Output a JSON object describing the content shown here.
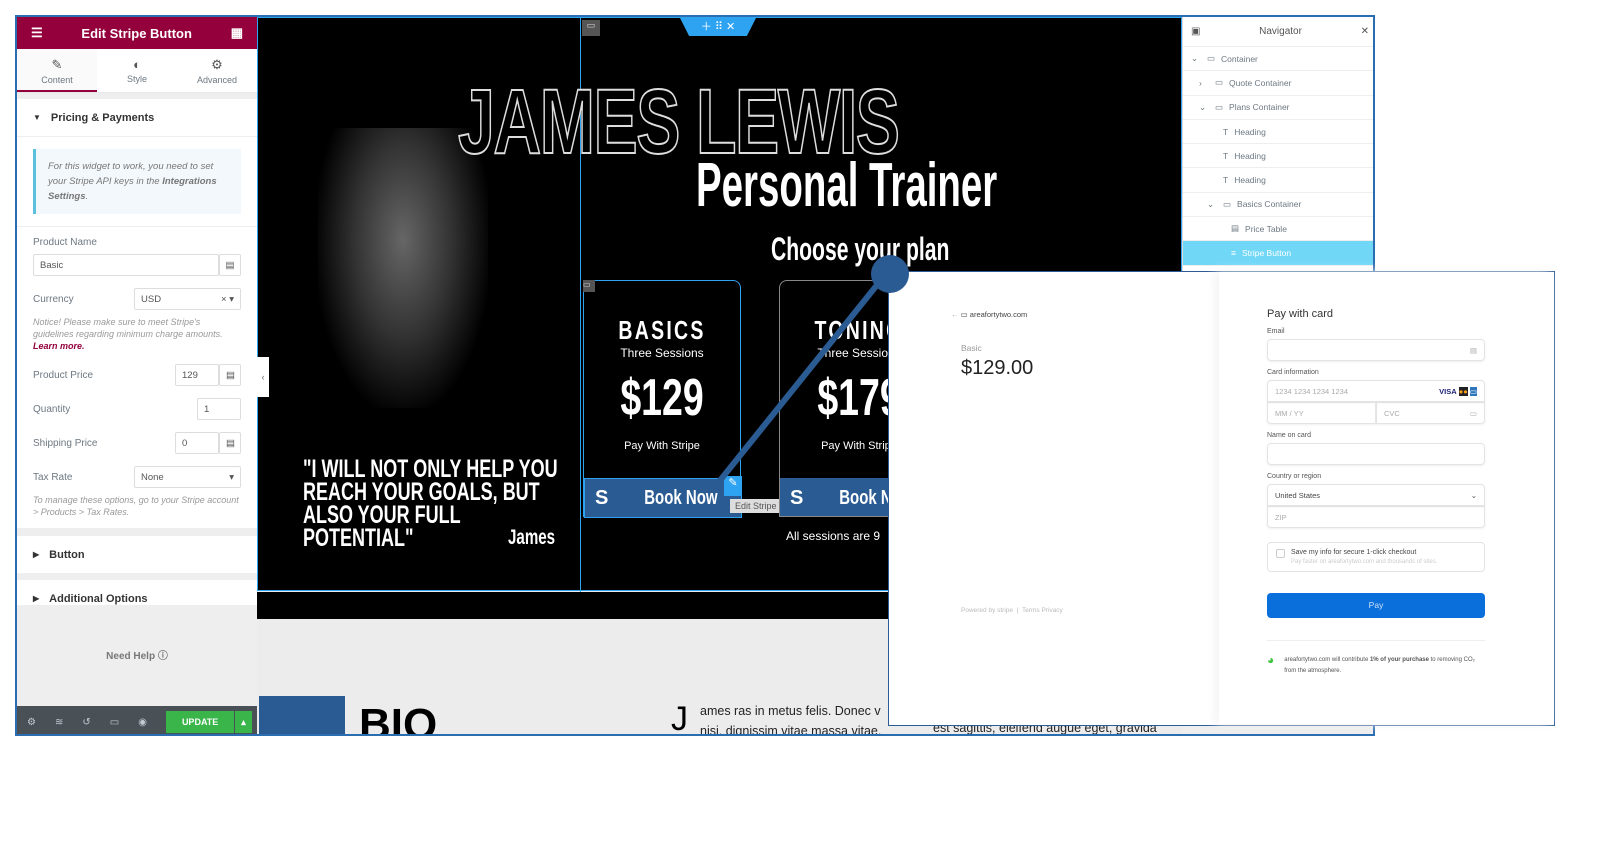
{
  "editor": {
    "title": "Edit Stripe Button",
    "tabs": [
      {
        "label": "Content",
        "icon": "pencil-icon"
      },
      {
        "label": "Style",
        "icon": "contrast-icon"
      },
      {
        "label": "Advanced",
        "icon": "gear-icon"
      }
    ],
    "section_pricing": "Pricing & Payments",
    "notice_pre": "For this widget to work, you need to set your Stripe API keys in the ",
    "notice_bold": "Integrations Settings",
    "notice_post": ".",
    "product_name_label": "Product Name",
    "product_name_value": "Basic",
    "currency_label": "Currency",
    "currency_value": "USD",
    "currency_note": "Notice! Please make sure to meet Stripe's guidelines regarding minimum charge amounts. ",
    "learn_more": "Learn more.",
    "price_label": "Product Price",
    "price_value": "129",
    "quantity_label": "Quantity",
    "quantity_value": "1",
    "shipping_label": "Shipping Price",
    "shipping_value": "0",
    "tax_label": "Tax Rate",
    "tax_value": "None",
    "tax_note": "To manage these options, go to your Stripe account > Products > Tax Rates.",
    "section_button": "Button",
    "section_additional": "Additional Options",
    "need_help": "Need Help",
    "update": "UPDATE",
    "accent": "#93003c"
  },
  "page": {
    "name_title": "JAMES LEWIS",
    "subtitle": "Personal Trainer",
    "choose": "Choose your plan",
    "quote": "\"I WILL NOT ONLY HELP YOU REACH YOUR GOALS, BUT ALSO YOUR FULL POTENTIAL\"",
    "quote_author": "James",
    "plans": [
      {
        "name": "BASICS",
        "sessions": "Three Sessions",
        "price": "$129",
        "pay": "Pay With Stripe",
        "button": "Book Now"
      },
      {
        "name": "TONING",
        "sessions": "Three Sessions",
        "price": "$179",
        "pay": "Pay With Stripe",
        "button": "Book Now"
      }
    ],
    "tooltip": "Edit Stripe Button",
    "sessions_note": "All sessions are 9",
    "bio": "BIO",
    "bio_text_1": "ames ras in metus felis. Donec v",
    "bio_text_2": "nisi, dignissim vitae massa vitae,",
    "bio_text_3": "est sagittis, eleifend augue eget, gravida",
    "dropcap": "J"
  },
  "navigator": {
    "title": "Navigator",
    "items": [
      {
        "label": "Container",
        "depth": 0,
        "icon": "box-icon"
      },
      {
        "label": "Quote Container",
        "depth": 1,
        "icon": "box-icon"
      },
      {
        "label": "Plans Container",
        "depth": 1,
        "icon": "box-icon"
      },
      {
        "label": "Heading",
        "depth": 2,
        "icon": "heading-icon"
      },
      {
        "label": "Heading",
        "depth": 2,
        "icon": "heading-icon"
      },
      {
        "label": "Heading",
        "depth": 2,
        "icon": "heading-icon"
      },
      {
        "label": "Basics Container",
        "depth": 2,
        "icon": "box-icon"
      },
      {
        "label": "Price Table",
        "depth": 3,
        "icon": "table-icon"
      },
      {
        "label": "Stripe Button",
        "depth": 3,
        "icon": "stripe-icon",
        "selected": true
      }
    ]
  },
  "checkout": {
    "domain": "areafortytwo.com",
    "product": "Basic",
    "amount": "$129.00",
    "powered": "Powered by stripe",
    "terms": "Terms",
    "privacy": "Privacy",
    "title": "Pay with card",
    "email_label": "Email",
    "card_label": "Card information",
    "card_placeholder": "1234 1234 1234 1234",
    "exp_placeholder": "MM / YY",
    "cvc_placeholder": "CVC",
    "name_label": "Name on card",
    "country_label": "Country or region",
    "country_value": "United States",
    "zip_placeholder": "ZIP",
    "save_label": "Save my info for secure 1-click checkout",
    "save_sub": "Pay faster on areafortytwo.com and thousands of sites.",
    "pay": "Pay",
    "climate_pre": "areafortytwo.com will contribute ",
    "climate_bold": "1% of your purchase",
    "climate_post": " to removing CO₂ from the atmosphere.",
    "pay_color": "#0a6edb"
  }
}
